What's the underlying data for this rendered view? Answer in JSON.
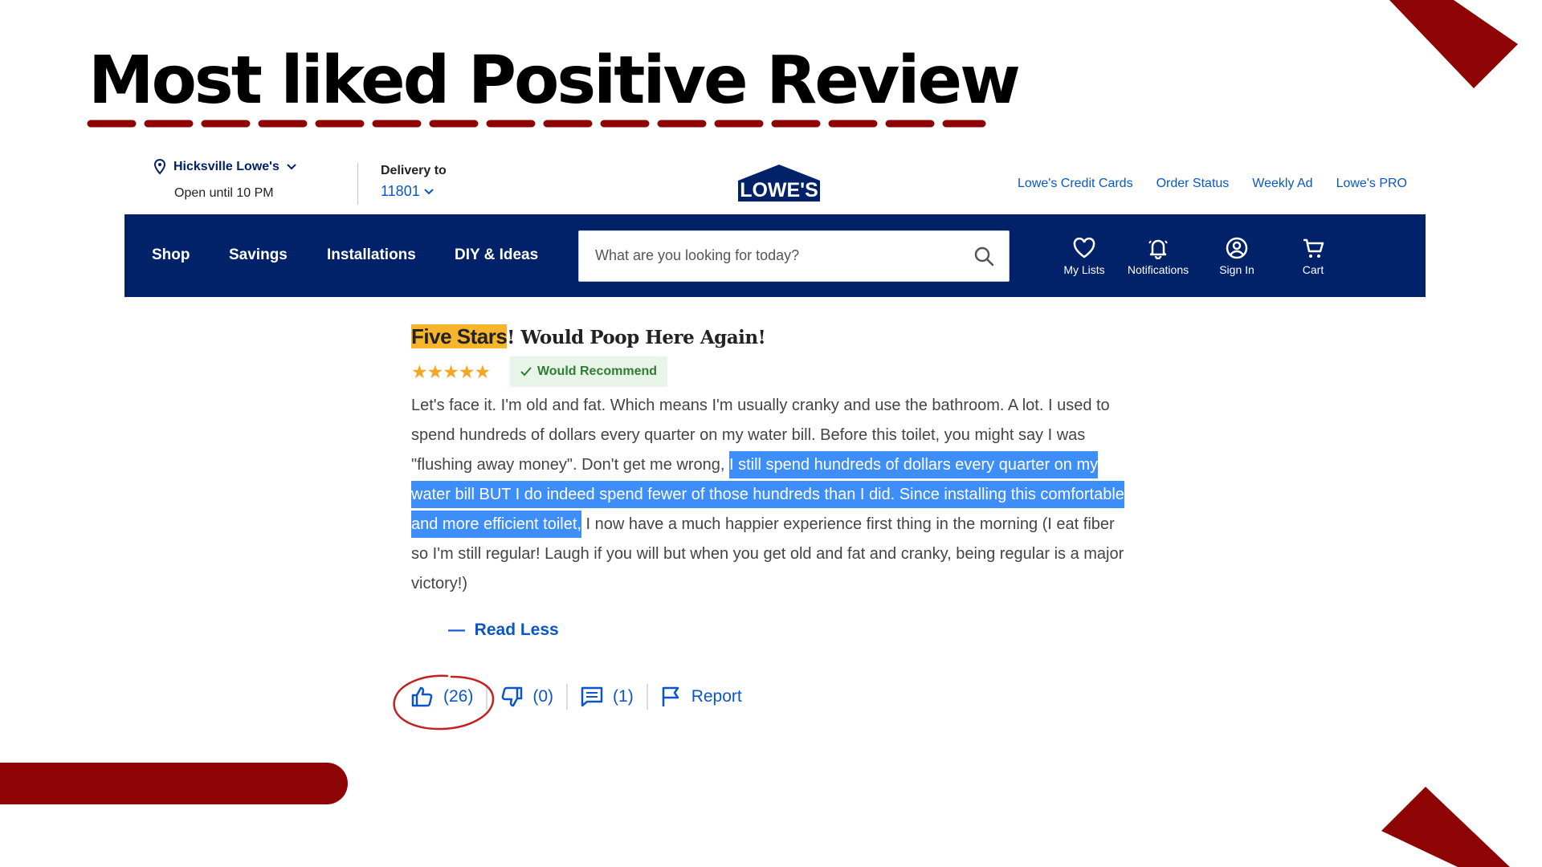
{
  "slide": {
    "title": "Most liked Positive Review"
  },
  "header": {
    "store_name": "Hicksville Lowe's",
    "store_hours": "Open until 10 PM",
    "delivery_label": "Delivery to",
    "delivery_zip": "11801",
    "logo_text": "LOWE'S",
    "top_links": [
      "Lowe's Credit Cards",
      "Order Status",
      "Weekly Ad",
      "Lowe's PRO"
    ]
  },
  "nav": {
    "items": [
      "Shop",
      "Savings",
      "Installations",
      "DIY & Ideas"
    ],
    "search_placeholder": "What are you looking for today?",
    "icons": [
      {
        "label": "My Lists",
        "icon": "heart-icon"
      },
      {
        "label": "Notifications",
        "icon": "bell-icon"
      },
      {
        "label": "Sign In",
        "icon": "user-icon"
      },
      {
        "label": "Cart",
        "icon": "cart-icon"
      }
    ]
  },
  "review": {
    "title_highlight": "Five Stars",
    "title_rest": "! Would Poop Here Again!",
    "stars": "★★★★★",
    "rating": 5,
    "recommend_label": "Would Recommend",
    "body_before": "Let's face it. I'm old and fat. Which means I'm usually cranky and use the bathroom. A lot. I used to spend hundreds of dollars every quarter on my water bill. Before this toilet, you might say I was \"flushing away money\". Don't get me wrong, ",
    "body_selected": "I still spend hundreds of dollars every quarter on my water bill BUT I do indeed spend fewer of those hundreds than I did. Since installing this comfortable and more efficient toilet,",
    "body_after": " I now have a much happier experience first thing in the morning (I eat fiber so I'm still regular! Laugh if you will but when you get old and fat and cranky, being regular is a major victory!)",
    "read_less_label": "Read Less",
    "helpful_count": "(26)",
    "unhelpful_count": "(0)",
    "comments_count": "(1)",
    "report_label": "Report"
  },
  "colors": {
    "accent_red": "#8e0303",
    "nav_blue": "#012169",
    "link_blue": "#0a56c9",
    "highlight_yellow": "#f7b52c",
    "selection_blue": "#3d8ef8"
  }
}
